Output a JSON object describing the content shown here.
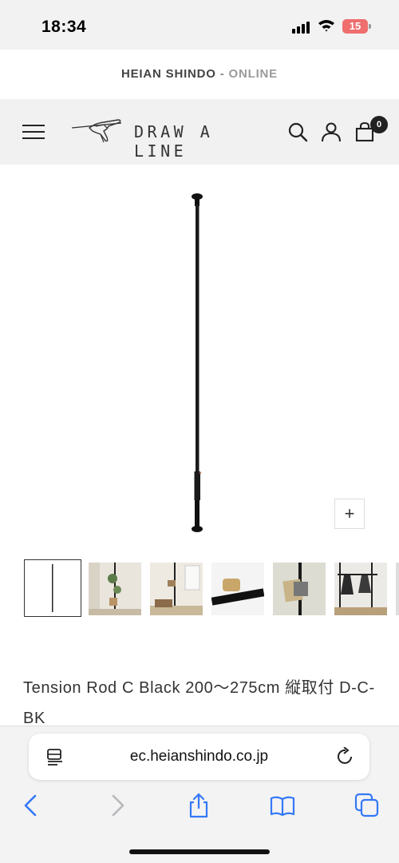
{
  "status": {
    "time": "18:34",
    "battery": "15",
    "signal_icon": "cellular-signal-icon",
    "wifi_icon": "wifi-icon"
  },
  "announcement": {
    "brand": "HEIAN SHINDO",
    "separator": " - ",
    "suffix": "ONLINE"
  },
  "header": {
    "menu_icon": "hamburger-menu-icon",
    "logo_text": "DRAW A LINE",
    "search_icon": "search-icon",
    "account_icon": "user-icon",
    "cart_icon": "shopping-bag-icon",
    "cart_count": "0"
  },
  "gallery": {
    "zoom_label": "+",
    "thumbnails": [
      {
        "name": "thumb-rod-product"
      },
      {
        "name": "thumb-rod-with-plants"
      },
      {
        "name": "thumb-rod-room-corner"
      },
      {
        "name": "thumb-rod-detail"
      },
      {
        "name": "thumb-rod-with-photo"
      },
      {
        "name": "thumb-rod-with-clothes"
      }
    ]
  },
  "product": {
    "title": "Tension Rod C Black 200〜275cm 縦取付 D-C-BK"
  },
  "browser": {
    "url": "ec.heianshindo.co.jp",
    "reader_icon": "page-menu-icon",
    "reload_icon": "reload-icon",
    "nav": [
      "back-icon",
      "forward-icon",
      "share-icon",
      "bookmarks-icon",
      "tabs-icon"
    ]
  },
  "colors": {
    "header_bg": "#f1f1f1",
    "accent_ios_blue": "#3478f6",
    "battery_low": "#e66666"
  }
}
